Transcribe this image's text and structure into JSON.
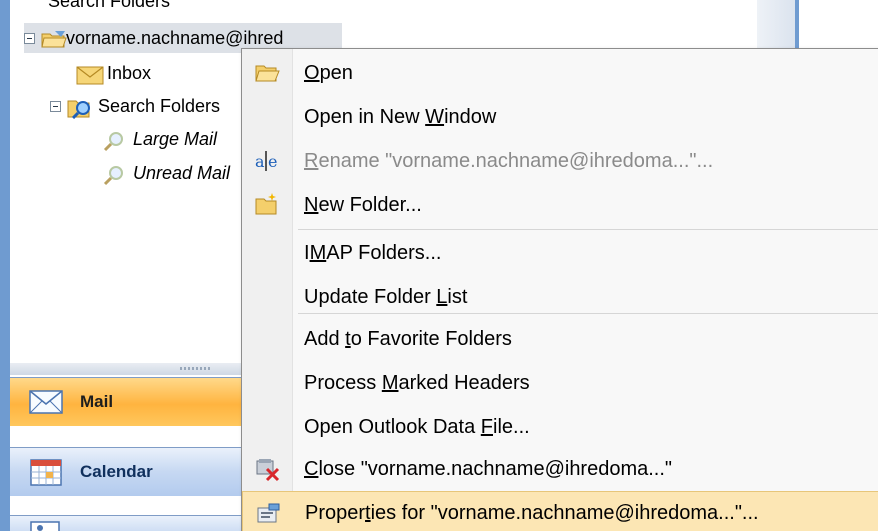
{
  "nav_tree": {
    "cut_top_label": "Search Folders",
    "account_label": "vorname.nachname@ihred",
    "inbox_label": "Inbox",
    "search_folders_label": "Search Folders",
    "large_mail_label": "Large Mail",
    "unread_mail_label": "Unread Mail"
  },
  "nav_buttons": {
    "mail": "Mail",
    "calendar": "Calendar"
  },
  "context_menu": {
    "open": {
      "pre": "",
      "u": "O",
      "post": "pen"
    },
    "open_new_window": {
      "pre": "Open in New ",
      "u": "W",
      "post": "indow"
    },
    "rename": {
      "pre": "",
      "u": "R",
      "post": "ename \"vorname.nachname@ihredoma...\"..."
    },
    "new_folder": {
      "pre": "",
      "u": "N",
      "post": "ew Folder..."
    },
    "imap_folders": {
      "pre": "I",
      "u": "M",
      "post": "AP Folders..."
    },
    "update_folder_list": {
      "pre": "Update Folder ",
      "u": "L",
      "post": "ist"
    },
    "add_favorites": {
      "pre": "Add ",
      "u": "t",
      "post": "o Favorite Folders"
    },
    "process_marked": {
      "pre": "Process ",
      "u": "M",
      "post": "arked Headers"
    },
    "open_data_file": {
      "pre": "Open Outlook Data ",
      "u": "F",
      "post": "ile..."
    },
    "close": {
      "pre": "",
      "u": "C",
      "post": "lose \"vorname.nachname@ihredoma...\""
    },
    "properties": {
      "pre": "Proper",
      "u": "t",
      "post": "ies for \"vorname.nachname@ihredoma...\"..."
    }
  },
  "colors": {
    "accent_blue": "#6f9bd0",
    "highlight": "#fce6b4",
    "mail_button": "#ffb43f"
  }
}
